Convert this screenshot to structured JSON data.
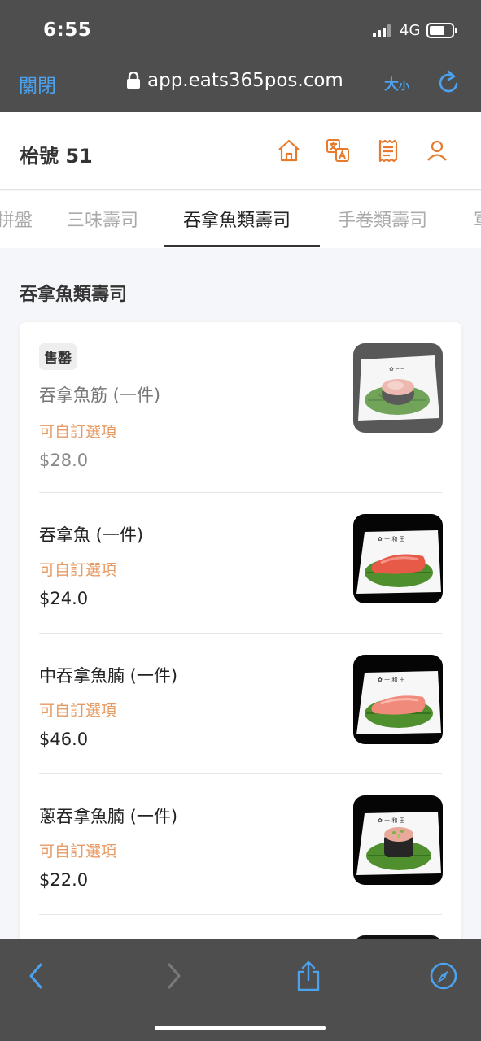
{
  "status_bar": {
    "time": "6:55",
    "network": "4G"
  },
  "browser": {
    "close_label": "關閉",
    "url": "app.eats365pos.com",
    "text_size_big": "大",
    "text_size_small": "小"
  },
  "header": {
    "title": "枱號 51",
    "icons": [
      "home-icon",
      "translate-icon",
      "receipt-icon",
      "user-icon"
    ]
  },
  "tabs": [
    {
      "label": "拼盤"
    },
    {
      "label": "三味壽司"
    },
    {
      "label": "吞拿魚類壽司",
      "active": true
    },
    {
      "label": "手卷類壽司"
    },
    {
      "label": "軍"
    }
  ],
  "section": {
    "title": "吞拿魚類壽司"
  },
  "items": [
    {
      "badge": "售罄",
      "name": "吞拿魚筋 (一件)",
      "option": "可自訂選項",
      "price": "$28.0",
      "sold_out": true
    },
    {
      "name": "吞拿魚 (一件)",
      "option": "可自訂選項",
      "price": "$24.0",
      "sold_out": false
    },
    {
      "name": "中吞拿魚腩 (一件)",
      "option": "可自訂選項",
      "price": "$46.0",
      "sold_out": false
    },
    {
      "name": "蔥吞拿魚腩 (一件)",
      "option": "可自訂選項",
      "price": "$22.0",
      "sold_out": false
    }
  ],
  "colors": {
    "accent": "#e87a2d",
    "option": "#e89a63",
    "ios_blue": "#4ba3f0",
    "chrome": "#4e4e4e"
  }
}
